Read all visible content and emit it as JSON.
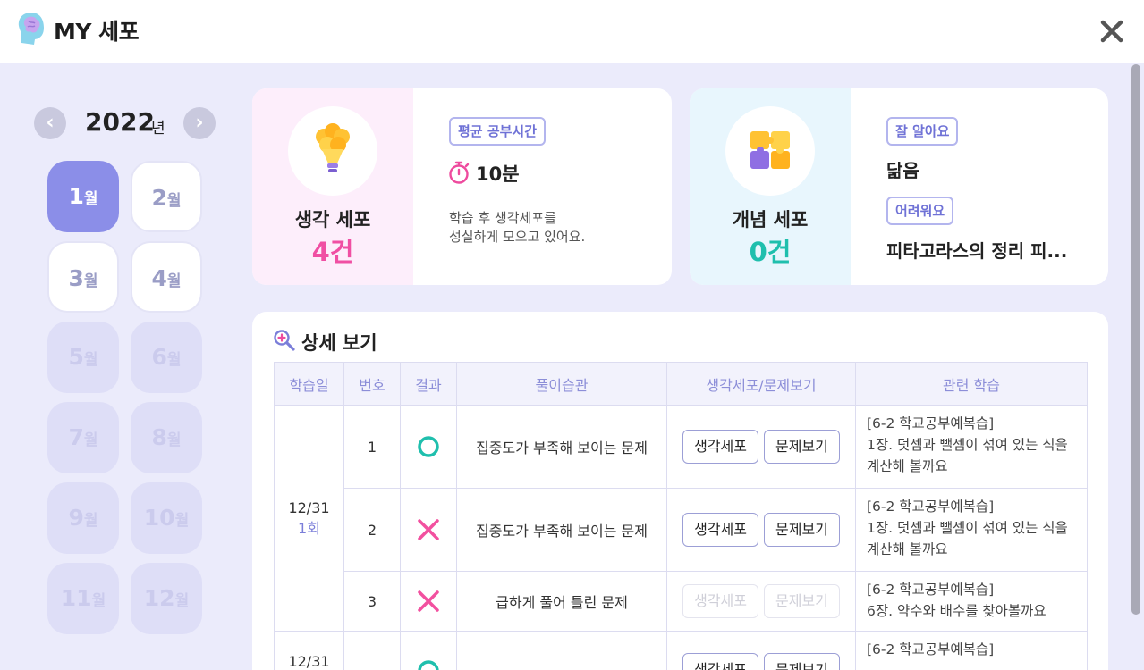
{
  "header": {
    "title": "MY 세포"
  },
  "sidebar": {
    "year": "2022",
    "year_suffix": "년",
    "prev_icon": "chevron-left-icon",
    "next_icon": "chevron-right-icon",
    "month_unit": "월",
    "months": [
      {
        "num": "1",
        "state": "active"
      },
      {
        "num": "2",
        "state": "available"
      },
      {
        "num": "3",
        "state": "available"
      },
      {
        "num": "4",
        "state": "available"
      },
      {
        "num": "5",
        "state": "disabled"
      },
      {
        "num": "6",
        "state": "disabled"
      },
      {
        "num": "7",
        "state": "disabled"
      },
      {
        "num": "8",
        "state": "disabled"
      },
      {
        "num": "9",
        "state": "disabled"
      },
      {
        "num": "10",
        "state": "disabled"
      },
      {
        "num": "11",
        "state": "disabled"
      },
      {
        "num": "12",
        "state": "disabled"
      }
    ]
  },
  "think_card": {
    "name": "생각 세포",
    "count": "4건",
    "tag": "평균 공부시간",
    "study_time": "10분",
    "desc_line1": "학습 후 생각세포를",
    "desc_line2": "성실하게 모으고 있어요."
  },
  "concept_card": {
    "name": "개념 세포",
    "count": "0건",
    "good_tag": "잘 알아요",
    "good_value": "닮음",
    "hard_tag": "어려워요",
    "hard_value": "피타고라스의 정리 피..."
  },
  "detail": {
    "title": "상세 보기",
    "headers": [
      "학습일",
      "번호",
      "결과",
      "풀이습관",
      "생각세포/문제보기",
      "관련 학습"
    ],
    "btn_cell": "생각세포",
    "btn_problem": "문제보기",
    "group1": {
      "date": "12/31",
      "round": "1회"
    },
    "group2": {
      "date": "12/31"
    },
    "rows": [
      {
        "no": "1",
        "result": "correct",
        "habit": "집중도가 부족해 보이는 문제",
        "rel1": "[6-2 학교공부예복습]",
        "rel2": "1장. 덧셈과 뺄셈이 섞여 있는 식을",
        "rel3": "계산해 볼까요"
      },
      {
        "no": "2",
        "result": "wrong",
        "habit": "집중도가 부족해 보이는 문제",
        "rel1": "[6-2 학교공부예복습]",
        "rel2": "1장. 덧셈과 뺄셈이 섞여 있는 식을",
        "rel3": "계산해 볼까요"
      },
      {
        "no": "3",
        "result": "wrong",
        "habit": "급하게 풀어 틀린 문제",
        "rel1": "[6-2 학교공부예복습]",
        "rel2": "6장. 약수와 배수를 찾아볼까요"
      },
      {
        "rel1": "[6-2 학교공부예복습]"
      }
    ]
  },
  "colors": {
    "accent": "#8b8ee8",
    "think": "#f04fa3",
    "concept": "#1fbfad"
  }
}
